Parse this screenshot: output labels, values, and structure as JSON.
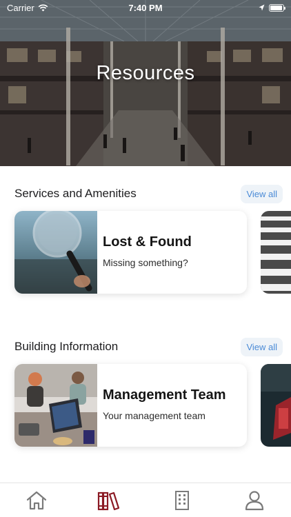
{
  "status_bar": {
    "carrier": "Carrier",
    "time": "7:40 PM",
    "battery_level": 0.95
  },
  "hero": {
    "title": "Resources"
  },
  "sections": [
    {
      "title": "Services and Amenities",
      "view_all_label": "View all",
      "cards": [
        {
          "title": "Lost & Found",
          "subtitle": "Missing something?",
          "image_icon": "magnifying-glass"
        }
      ]
    },
    {
      "title": "Building Information",
      "view_all_label": "View all",
      "cards": [
        {
          "title": "Management Team",
          "subtitle": "Your management team",
          "image_icon": "laptop-meeting"
        }
      ]
    }
  ],
  "tab_bar": {
    "active_color": "#8b1a24",
    "inactive_color": "#7a7a7a",
    "tabs": [
      {
        "icon": "home-icon",
        "active": false
      },
      {
        "icon": "books-icon",
        "active": true
      },
      {
        "icon": "building-icon",
        "active": false
      },
      {
        "icon": "profile-icon",
        "active": false
      }
    ]
  }
}
